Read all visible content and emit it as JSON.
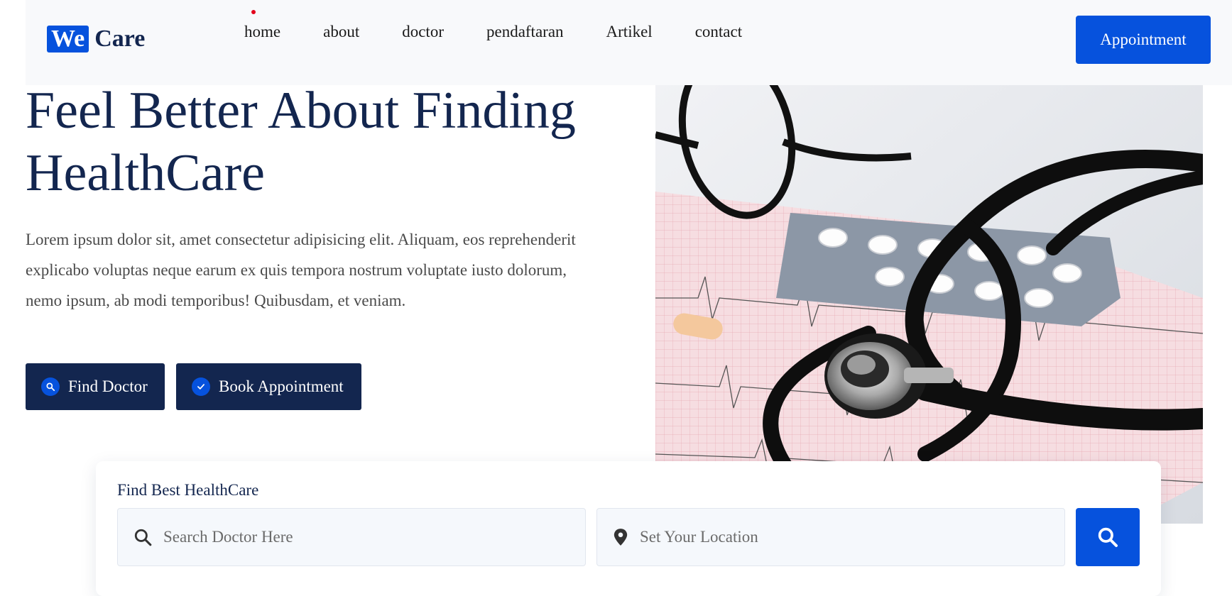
{
  "header": {
    "logo": {
      "badge": "We",
      "text": "Care"
    },
    "nav": [
      {
        "label": "home"
      },
      {
        "label": "about"
      },
      {
        "label": "doctor"
      },
      {
        "label": "pendaftaran"
      },
      {
        "label": "Artikel"
      },
      {
        "label": "contact"
      }
    ],
    "appointment_label": "Appointment"
  },
  "hero": {
    "title": "Feel Better About Finding HealthCare",
    "text": "Lorem ipsum dolor sit, amet consectetur adipisicing elit. Aliquam, eos reprehenderit explicabo voluptas neque earum ex quis tempora nostrum voluptate iusto dolorum, nemo ipsum, ab modi temporibus! Quibusdam, et veniam.",
    "find_doctor_label": "Find Doctor",
    "book_appointment_label": "Book Appointment"
  },
  "search": {
    "title": "Find Best HealthCare",
    "doctor_placeholder": "Search Doctor Here",
    "location_placeholder": "Set Your Location"
  },
  "icons": {
    "search": "search-icon",
    "check": "check-icon",
    "location": "map-pin-icon"
  },
  "colors": {
    "primary": "#0652dd",
    "navy": "#13264f",
    "header_bg": "#f8f9fb"
  }
}
